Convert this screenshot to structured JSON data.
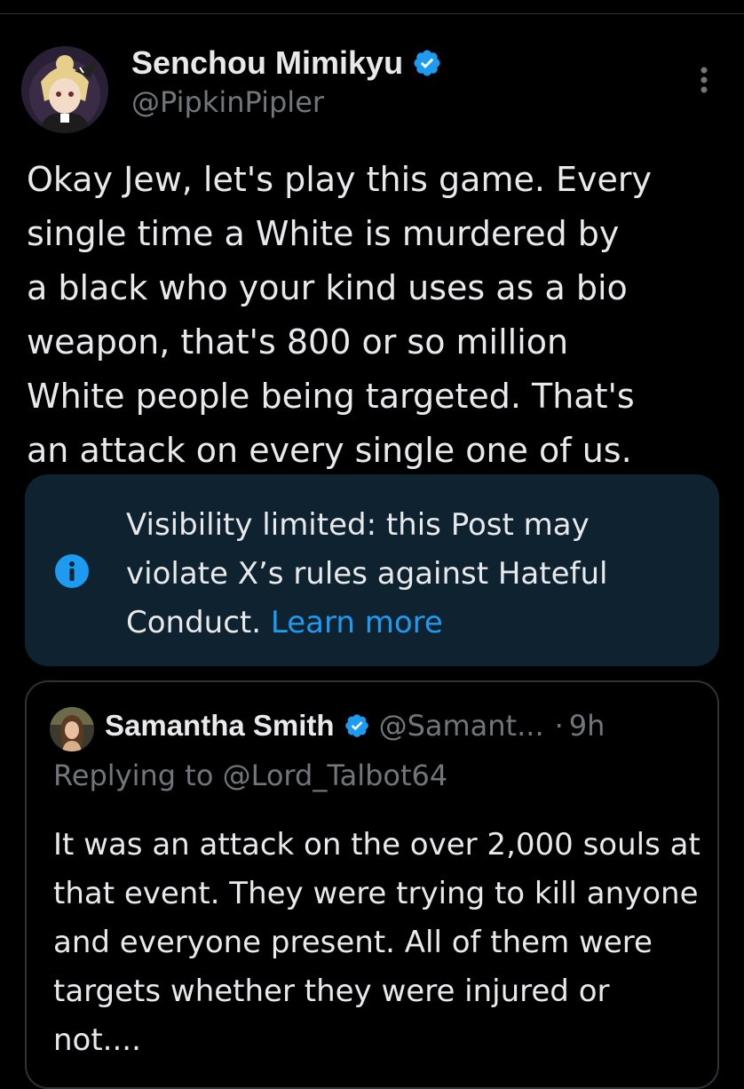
{
  "post": {
    "author_name": "Senchou Mimikyu",
    "author_handle": "@PipkinPipler",
    "text": "Okay Jew, let's play this game. Every\nsingle time a White is murdered by\na black who your kind uses as a bio\nweapon, that's 800 or so million\nWhite people being targeted. That's\nan attack on every single one of us.",
    "verified": true
  },
  "notice": {
    "text": "Visibility limited: this Post may violate X’s rules against Hateful Conduct.",
    "link_label": "Learn more",
    "icon": "info-icon"
  },
  "quoted_post": {
    "author_name": "Samantha Smith",
    "author_handle": "@Samant...",
    "separator": "·",
    "time": "9h",
    "replying_prefix": "Replying to",
    "replying_to": "@Lord_Talbot64",
    "text": "It was an attack on the over 2,000 souls at that event. They were trying to kill anyone and everyone present. All of them were targets whether they were injured or not...."
  },
  "icons": {
    "more": "more-vertical-icon",
    "verified": "verified-badge-icon"
  },
  "colors": {
    "background": "#000000",
    "text_primary": "#e7e9ea",
    "text_secondary": "#71767b",
    "accent": "#1d9bf0",
    "notice_background": "#0f2230",
    "border": "#2f3336"
  }
}
